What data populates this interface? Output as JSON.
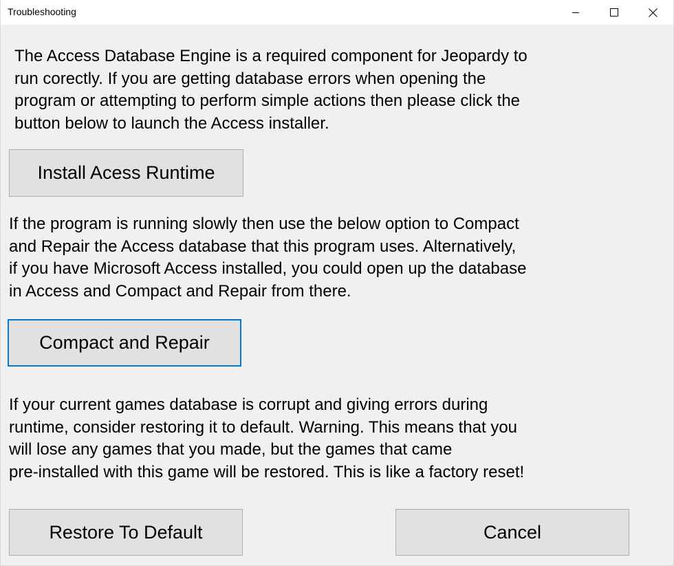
{
  "window": {
    "title": "Troubleshooting"
  },
  "titlebar_icons": {
    "minimize": "minimize-icon",
    "maximize": "maximize-icon",
    "close": "close-icon"
  },
  "sections": {
    "access_runtime": {
      "lines": [
        "The Access Database Engine is a required component for Jeopardy to",
        "run corectly. If you are getting database errors when opening the",
        "program or attempting to perform simple actions then please click the",
        "button below to launch the Access installer."
      ],
      "button_label": "Install Acess Runtime"
    },
    "compact_repair": {
      "lines": [
        "If the program is running slowly then use the below option to Compact",
        "and Repair the Access database that this program uses. Alternatively,",
        "if you have Microsoft Access installed, you could open up the database",
        "in Access and Compact and Repair from there."
      ],
      "button_label": "Compact and Repair"
    },
    "restore_default": {
      "lines": [
        "If your current games database is corrupt and giving errors during",
        "runtime, consider restoring it to default. Warning. This means that you",
        "will lose any games that you made, but the games that came",
        "pre-installed with this game will be restored. This is like a factory reset!"
      ],
      "button_label": "Restore To Default"
    }
  },
  "footer": {
    "cancel_label": "Cancel"
  },
  "colors": {
    "focus_border": "#0078d7",
    "button_face": "#e1e1e1",
    "window_bg": "#f0f0f0"
  }
}
